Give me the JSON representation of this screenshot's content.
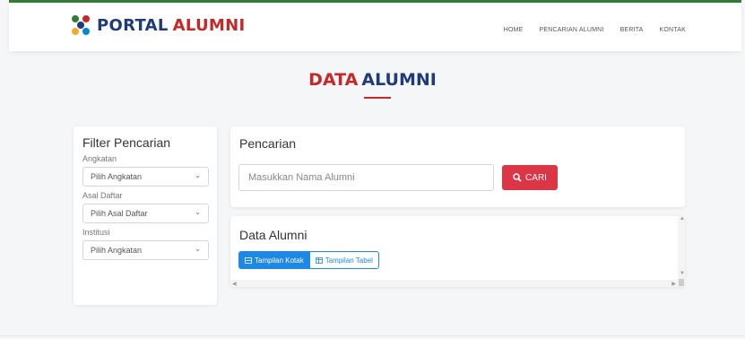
{
  "brand": {
    "name_part1": "PORTAL",
    "name_part2": "ALUMNI",
    "colors": {
      "primary": "#1f3b7a",
      "accent": "#c62828"
    }
  },
  "nav": {
    "items": [
      "HOME",
      "PENCARIAN ALUMNI",
      "BERITA",
      "KONTAK"
    ]
  },
  "page_title": {
    "part1": "DATA",
    "part2": "ALUMNI"
  },
  "filter": {
    "title": "Filter Pencarian",
    "fields": [
      {
        "label": "Angkatan",
        "selected": "Pilih Angkatan"
      },
      {
        "label": "Asal Daftar",
        "selected": "Pilih Asal Daftar"
      },
      {
        "label": "Institusi",
        "selected": "Pilih Angkatan"
      }
    ]
  },
  "search": {
    "title": "Pencarian",
    "placeholder": "Masukkan Nama Alumni",
    "button_label": "CARI",
    "button_color": "#dc3545"
  },
  "data": {
    "title": "Data Alumni",
    "view_box_label": "Tampilan Kotak",
    "view_table_label": "Tampilan Tabel",
    "accent": "#1e88e5"
  }
}
